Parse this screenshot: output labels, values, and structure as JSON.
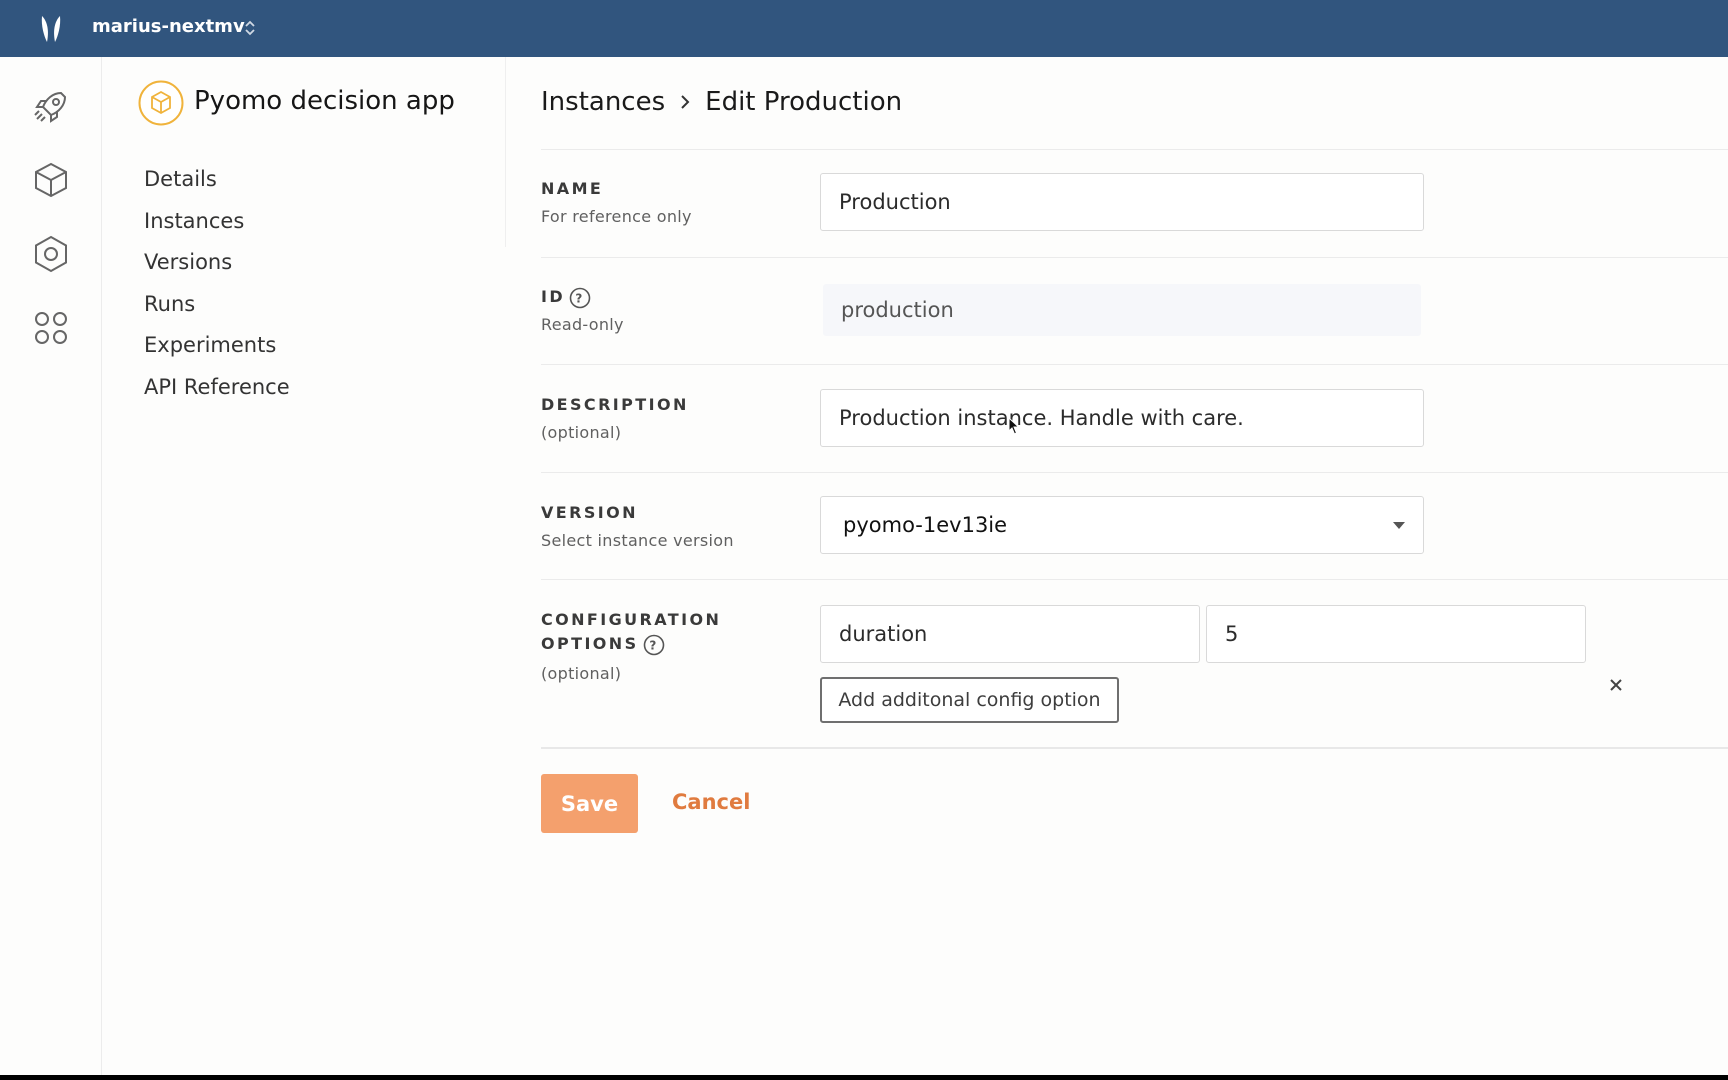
{
  "topbar": {
    "org_name": "marius-nextmv",
    "logo_icon": "nextmv-logo",
    "switcher_icon": "chevron-up-down-icon"
  },
  "rail": {
    "items": [
      {
        "icon": "rocket-icon"
      },
      {
        "icon": "cube-icon"
      },
      {
        "icon": "hexagon-icon"
      },
      {
        "icon": "apps-grid-icon"
      }
    ]
  },
  "app": {
    "title": "Pyomo decision app",
    "nav": [
      "Details",
      "Instances",
      "Versions",
      "Runs",
      "Experiments",
      "API Reference"
    ]
  },
  "breadcrumb": {
    "parent": "Instances",
    "current": "Edit Production"
  },
  "form": {
    "name": {
      "label": "NAME",
      "sub": "For reference only",
      "value": "Production"
    },
    "id": {
      "label": "ID",
      "sub": "Read-only",
      "value": "production"
    },
    "description": {
      "label": "DESCRIPTION",
      "sub": "(optional)",
      "value": "Production instance. Handle with care."
    },
    "version": {
      "label": "VERSION",
      "sub": "Select instance version",
      "value": "pyomo-1ev13ie"
    },
    "config": {
      "label_line1": "CONFIGURATION",
      "label_line2": "OPTIONS",
      "sub": "(optional)",
      "option_key": "duration",
      "option_value": "5",
      "add_label": "Add additonal config option"
    }
  },
  "actions": {
    "save": "Save",
    "cancel": "Cancel"
  },
  "colors": {
    "topbar": "#31557e",
    "accent": "#f4a06d",
    "cancel": "#e07b3f",
    "app_badge": "#f0b33b"
  }
}
